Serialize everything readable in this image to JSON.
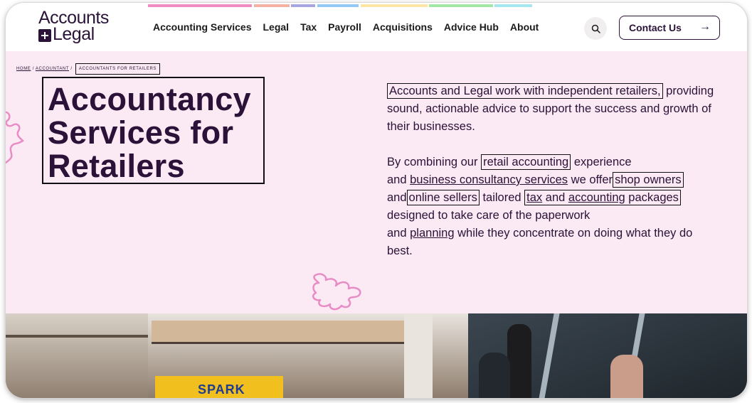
{
  "brand": {
    "line1": "Accounts",
    "line2": "Legal"
  },
  "colors": {
    "dark_text": "#2a1238",
    "page_bg": "#fbe9f3",
    "puzzle_pink": "#e88cc6",
    "strips": [
      "#ef8cc0",
      "#f5b2a2",
      "#a8a5e0",
      "#93c9f2",
      "#fbe6a6",
      "#a3e7a6",
      "#a6e6ef"
    ]
  },
  "nav": {
    "items": [
      {
        "label": "Accounting Services"
      },
      {
        "label": "Legal"
      },
      {
        "label": "Tax"
      },
      {
        "label": "Payroll"
      },
      {
        "label": "Acquisitions"
      },
      {
        "label": "Advice Hub"
      },
      {
        "label": "About"
      }
    ],
    "search_icon": "search-icon",
    "contact_label": "Contact Us",
    "contact_arrow": "→"
  },
  "breadcrumb": {
    "home": "HOME",
    "sep": "/",
    "accountant": "ACCOUNTANT",
    "current": "ACCOUNTANTS FOR RETAILERS"
  },
  "hero": {
    "title_line1": "Accountancy",
    "title_line2": "Services for",
    "title_line3": "Retailers"
  },
  "copy": {
    "p1_boxed": "Accounts and Legal work with independent retailers,",
    "p1_rest": "providing sound, actionable advice to support the success and growth of their businesses.",
    "p2_a": "By combining our",
    "p2_retail": "retail accounting",
    "p2_b": "experience",
    "p2_and1": "and",
    "p2_bcs": "business consultancy services",
    "p2_c": "we offer",
    "p2_shop": "shop owners",
    "p2_and2": "and",
    "p2_online": "online sellers",
    "p2_d": "tailored",
    "p2_tax": "tax",
    "p2_and3": "and",
    "p2_acc": "accounting",
    "p2_e": "packages",
    "p2_f": "designed to take care of the paperwork",
    "p2_and4": "and",
    "p2_planning": "planning",
    "p2_g": "while they concentrate on doing what they do best."
  },
  "photo": {
    "sign_text": "SPARK",
    "alt": "shopping-mall-photo"
  }
}
